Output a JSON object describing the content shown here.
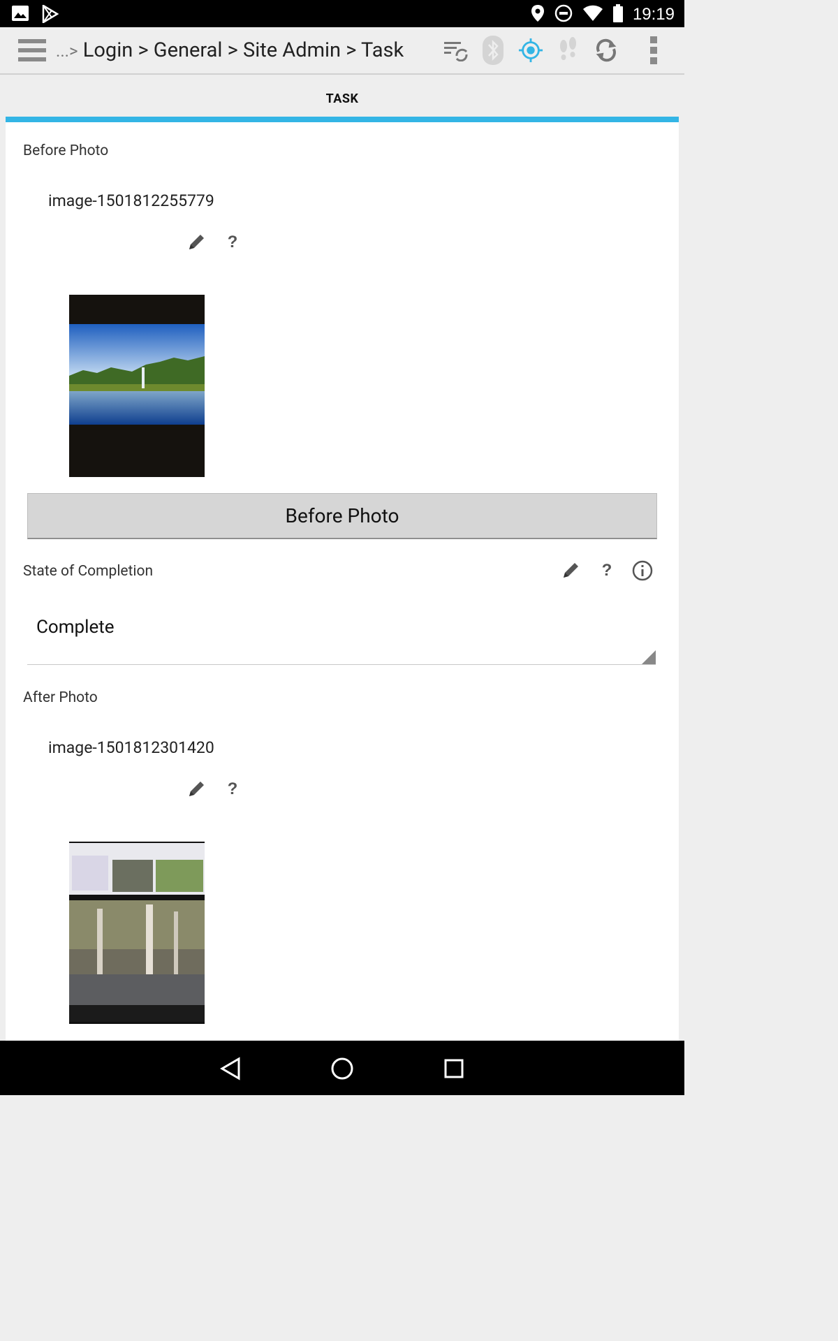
{
  "status_bar": {
    "time": "19:19",
    "left_icons": [
      "image-icon",
      "play-store-icon"
    ],
    "right_icons": [
      "location-icon",
      "do-not-disturb-icon",
      "wifi-icon",
      "battery-icon"
    ]
  },
  "action_bar": {
    "breadcrumb_prefix": "...>",
    "breadcrumb": "Login > General > Site Admin > Task",
    "icons": [
      "menu-icon",
      "sync-list-icon",
      "bluetooth-icon",
      "gps-target-icon",
      "footsteps-icon",
      "refresh-icon",
      "overflow-menu-icon"
    ],
    "accent_color": "#33b5e5"
  },
  "tabs": [
    {
      "label": "TASK",
      "selected": true
    }
  ],
  "form": {
    "before_photo": {
      "label": "Before Photo",
      "filename": "image-1501812255779",
      "button_label": "Before Photo"
    },
    "state_of_completion": {
      "label": "State of Completion",
      "selected_value": "Complete"
    },
    "after_photo": {
      "label": "After Photo",
      "filename": "image-1501812301420"
    }
  },
  "nav_bar": {
    "icons": [
      "back-icon",
      "home-icon",
      "recents-icon"
    ]
  }
}
